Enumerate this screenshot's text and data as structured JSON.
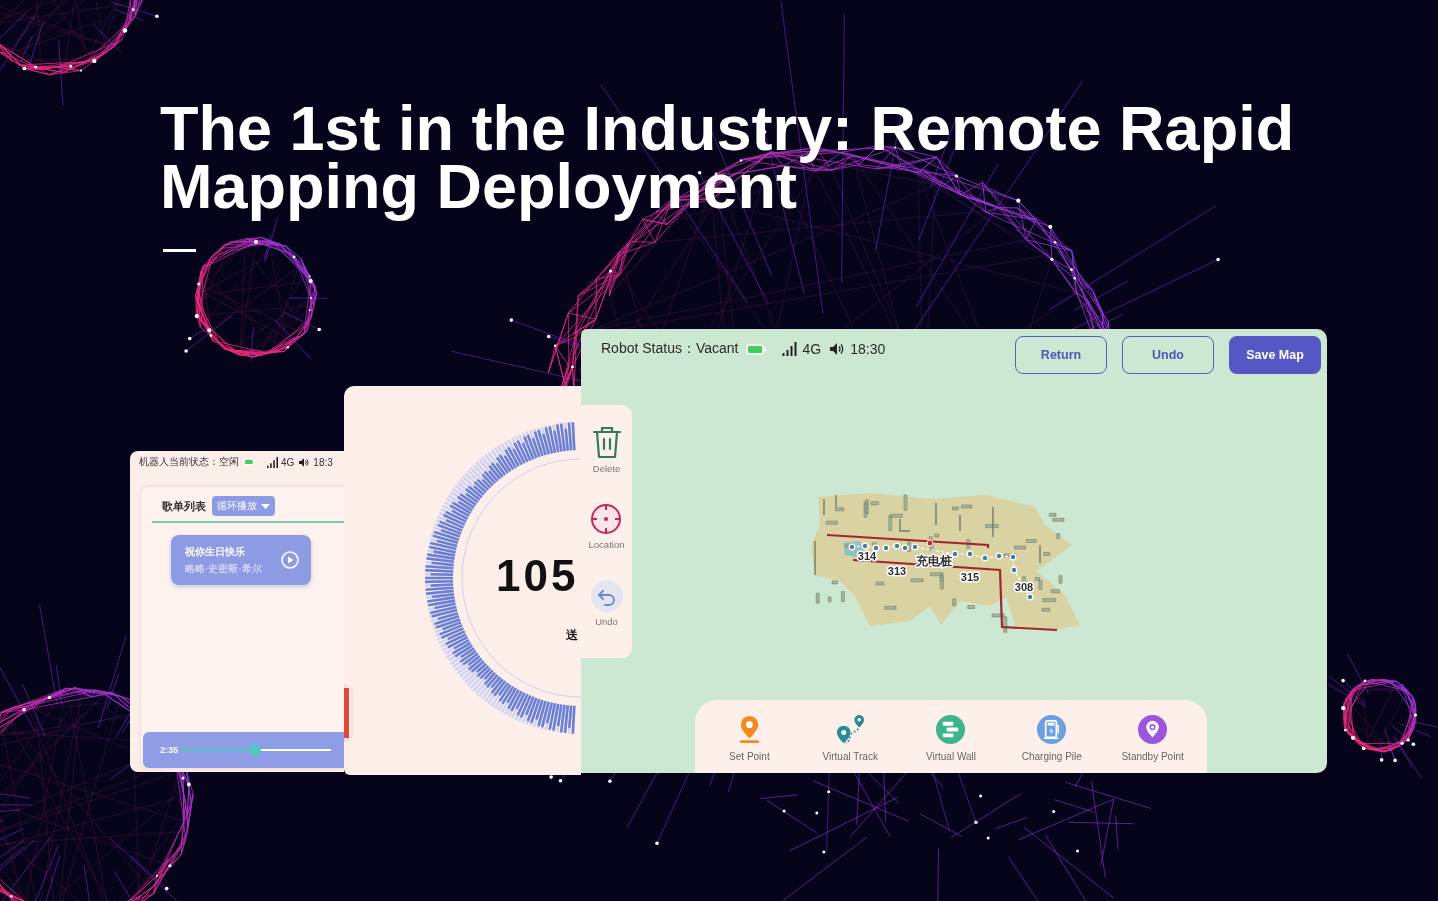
{
  "headline": {
    "title": "The 1st in the Industry: Remote Rapid Mapping Deployment"
  },
  "music_screen": {
    "status_bar": {
      "status": "机器人当前状态：空闲",
      "network": "4G",
      "time": "18:3"
    },
    "playlist": {
      "title": "歌单列表",
      "mode": "循环播放",
      "songs": [
        {
          "title": "祝你生日快乐",
          "artist": "略略·史密斯·希尔"
        }
      ]
    },
    "player": {
      "time": "2:35",
      "level": 0.49
    }
  },
  "gauge_screen": {
    "value": "105",
    "caption": "送"
  },
  "map_screen": {
    "status_bar": {
      "status": "Robot Status：Vacant",
      "network": "4G",
      "time": "18:30"
    },
    "buttons": [
      {
        "label": "Return",
        "kind": "outline"
      },
      {
        "label": "Undo",
        "kind": "outline"
      },
      {
        "label": "Save Map",
        "kind": "primary"
      }
    ],
    "side_tools": [
      {
        "label": "Delete",
        "kind": "delete"
      },
      {
        "label": "Location",
        "kind": "location"
      },
      {
        "label": "Undo",
        "kind": "undo"
      }
    ],
    "map": {
      "labels": [
        "314",
        "313",
        "充电桩",
        "315",
        "308"
      ]
    },
    "tools": [
      {
        "label": "Set Point",
        "kind": "set_point"
      },
      {
        "label": "Virtual Track",
        "kind": "virtual_track"
      },
      {
        "label": "Virtual Wall",
        "kind": "virtual_wall"
      },
      {
        "label": "Charging Pile",
        "kind": "charging_pile"
      },
      {
        "label": "Standby Point",
        "kind": "standby_point"
      }
    ]
  }
}
